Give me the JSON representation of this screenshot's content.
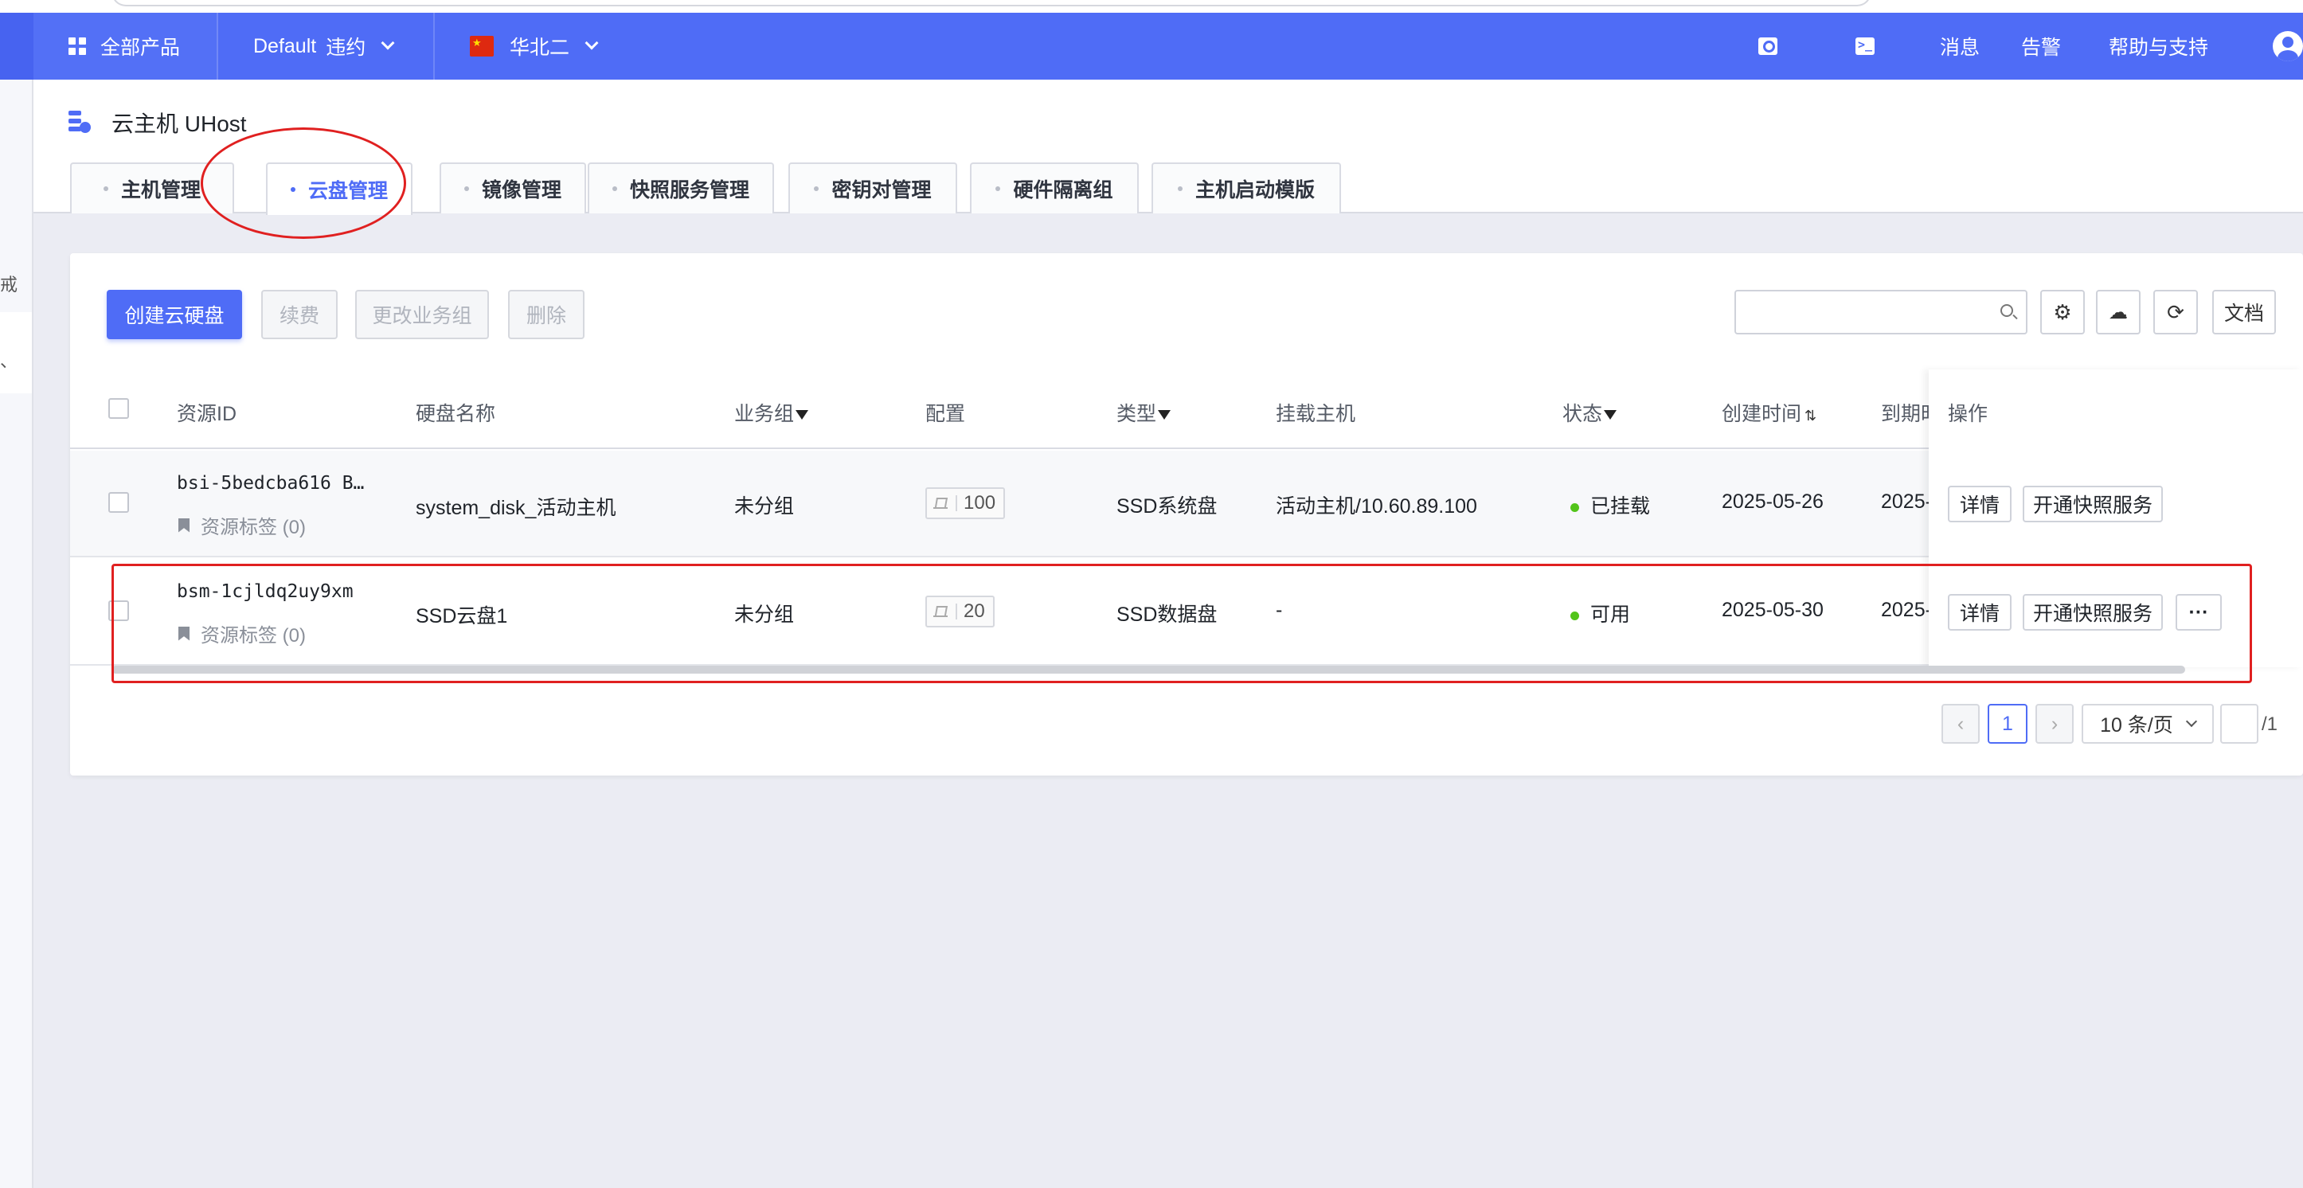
{
  "nav": {
    "all_products": "全部产品",
    "project": "Default",
    "project_status": "违约",
    "region": "华北二",
    "messages": "消息",
    "alerts": "告警",
    "help": "帮助与支持"
  },
  "rail": {
    "item_a": "戒",
    "item_b": "、"
  },
  "page": {
    "title": "云主机 UHost",
    "tabs": [
      "主机管理",
      "云盘管理",
      "镜像管理",
      "快照服务管理",
      "密钥对管理",
      "硬件隔离组",
      "主机启动模版"
    ],
    "active_tab": "云盘管理"
  },
  "toolbar": {
    "create": "创建云硬盘",
    "renew": "续费",
    "change_group": "更改业务组",
    "delete": "删除",
    "docs": "文档",
    "search_placeholder": ""
  },
  "table": {
    "headers": {
      "resource_id": "资源ID",
      "disk_name": "硬盘名称",
      "group": "业务组",
      "config": "配置",
      "type": "类型",
      "host": "挂载主机",
      "status": "状态",
      "created": "创建时间",
      "expires": "到期时",
      "actions": "操作"
    },
    "rows": [
      {
        "id": "bsi-5bedcba616  B…",
        "tag": "资源标签 (0)",
        "name": "system_disk_活动主机",
        "group": "未分组",
        "size": "100",
        "type": "SSD系统盘",
        "host": "活动主机/10.60.89.100",
        "status": "已挂载",
        "created": "2025-05-26",
        "expires": "2025-",
        "btn_detail": "详情",
        "btn_snapshot": "开通快照服务"
      },
      {
        "id": "bsm-1cjldq2uy9xm",
        "tag": "资源标签 (0)",
        "name": "SSD云盘1",
        "group": "未分组",
        "size": "20",
        "type": "SSD数据盘",
        "host": "-",
        "status": "可用",
        "created": "2025-05-30",
        "expires": "2025-",
        "btn_detail": "详情",
        "btn_snapshot": "开通快照服务",
        "btn_more": "···"
      }
    ]
  },
  "pagination": {
    "prev": "‹",
    "current": "1",
    "next": "›",
    "page_size": "10 条/页",
    "jump_value": "",
    "total_pages": "/1"
  },
  "colors": {
    "brand": "#4f6cf6",
    "annotation": "#e02020",
    "status_ok": "#52c41a"
  }
}
